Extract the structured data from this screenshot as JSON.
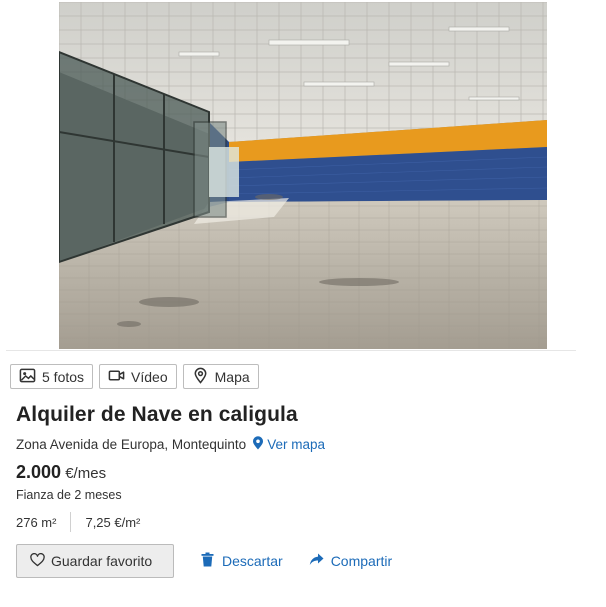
{
  "listing": {
    "title": "Alquiler de Nave en caligula",
    "location": "Zona Avenida de Europa, Montequinto",
    "map_link": "Ver mapa",
    "price_amount": "2.000",
    "price_unit": "€/mes",
    "deposit": "Fianza de 2 meses",
    "area": "276 m²",
    "price_per_m2": "7,25 €/m²"
  },
  "media": {
    "photos": "5 fotos",
    "video": "Vídeo",
    "map": "Mapa"
  },
  "actions": {
    "favorite": "Guardar favorito",
    "discard": "Descartar",
    "share": "Compartir"
  },
  "colors": {
    "link": "#1c6bb8",
    "wall_blue": "#2f4f8f",
    "wall_orange": "#e89a1e"
  },
  "icons": {
    "photos": "image-icon",
    "video": "video-camera-icon",
    "map": "map-pin-icon",
    "map_link": "location-pin-icon",
    "favorite": "heart-icon",
    "discard": "trash-icon",
    "share": "share-arrow-icon"
  }
}
